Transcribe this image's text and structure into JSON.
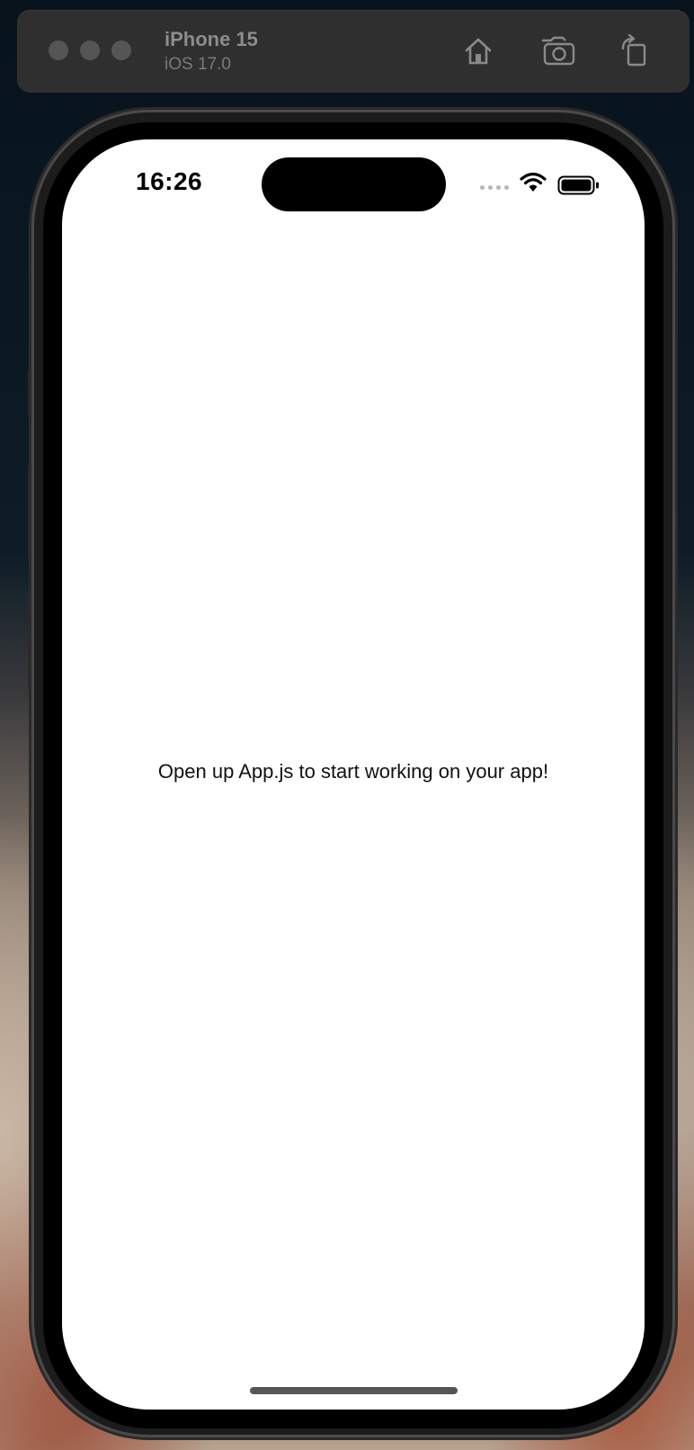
{
  "simulator": {
    "device_name": "iPhone 15",
    "os_version": "iOS 17.0",
    "toolbar": {
      "home_icon": "home-icon",
      "screenshot_icon": "camera-icon",
      "rotate_icon": "rotate-icon"
    }
  },
  "status_bar": {
    "time": "16:26",
    "icons": [
      "cellular-icon",
      "wifi-icon",
      "battery-icon"
    ]
  },
  "app": {
    "message": "Open up App.js to start working on your app!"
  },
  "colors": {
    "screen_background": "#ffffff",
    "text": "#111111"
  }
}
